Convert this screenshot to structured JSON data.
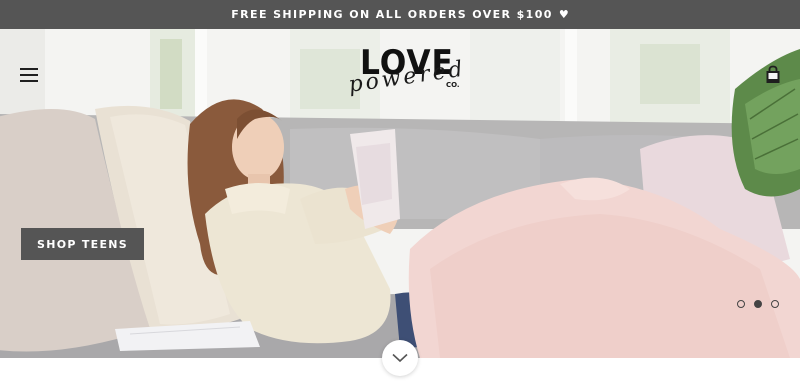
{
  "announcement": {
    "text": "FREE SHIPPING ON ALL ORDERS OVER $100",
    "icon": "heart-icon"
  },
  "header": {
    "menu_icon": "hamburger-menu-icon",
    "logo": {
      "main": "LOVE",
      "script": "powered",
      "suffix": "CO."
    },
    "cart_icon": "shopping-bag-icon"
  },
  "hero": {
    "cta_label": "SHOP TEENS",
    "slides": {
      "count": 3,
      "active_index": 2
    },
    "scroll_icon": "chevron-down-icon"
  },
  "colors": {
    "announcement_bg": "#555555",
    "cta_bg": "#555555",
    "text_dark": "#111111"
  }
}
